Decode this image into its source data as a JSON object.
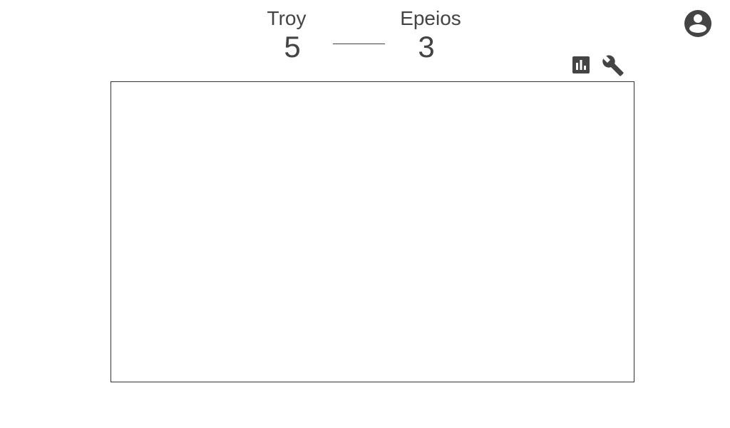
{
  "scoreboard": {
    "left_team": {
      "name": "Troy",
      "score": "5"
    },
    "right_team": {
      "name": "Epeios",
      "score": "3"
    }
  },
  "toolbar": {
    "stats_icon": "bar-chart-icon",
    "settings_icon": "wrench-icon",
    "account_icon": "account-circle-icon"
  },
  "colors": {
    "text": "#444444",
    "icon": "#444444",
    "board_border": "#333333",
    "background": "#ffffff"
  }
}
